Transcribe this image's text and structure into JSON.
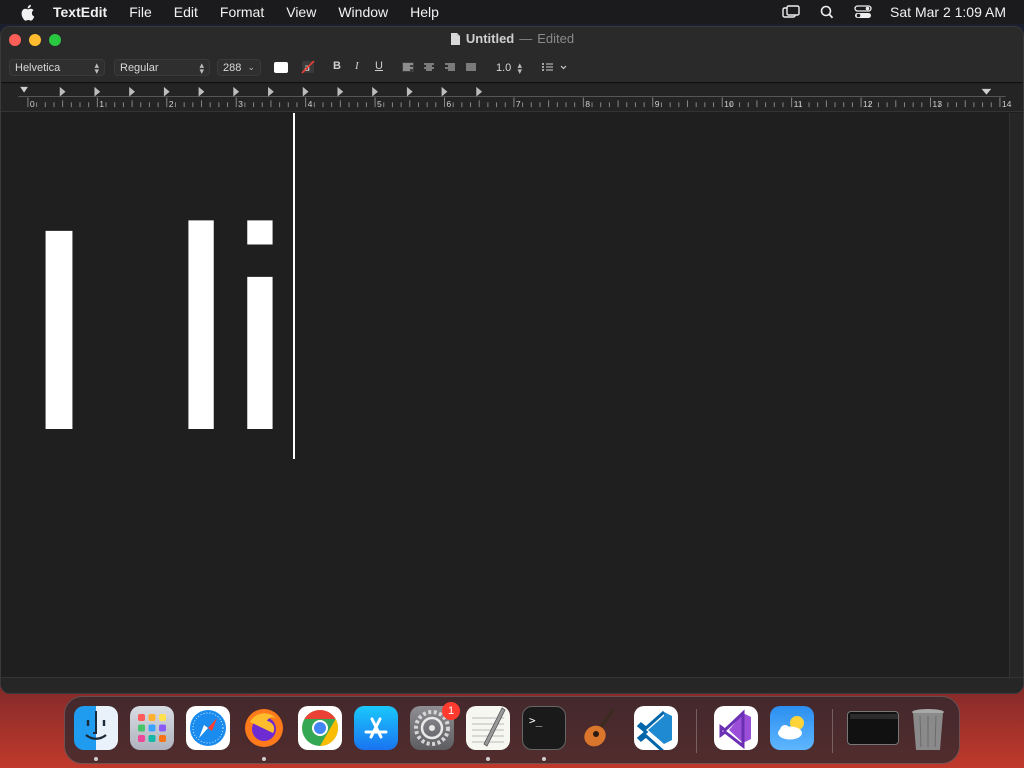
{
  "menubar": {
    "app_name": "TextEdit",
    "menus": [
      "File",
      "Edit",
      "Format",
      "View",
      "Window",
      "Help"
    ],
    "clock": "Sat Mar 2  1:09 AM",
    "status_icons": [
      "screen-mirroring-icon",
      "search-icon",
      "control-center-icon"
    ]
  },
  "window": {
    "title": "Untitled",
    "separator": "—",
    "state": "Edited"
  },
  "toolbar": {
    "font_family": "Helvetica",
    "font_style": "Regular",
    "font_size": "288",
    "bold_label": "B",
    "italic_label": "I",
    "underline_label": "U",
    "line_spacing": "1.0",
    "text_color": "#ffffff"
  },
  "ruler": {
    "marks": [
      "0",
      "1",
      "2",
      "3",
      "4",
      "5",
      "6",
      "7",
      "8",
      "9",
      "10",
      "11",
      "12",
      "13",
      "14"
    ]
  },
  "document": {
    "text": [
      "I",
      "l",
      "i"
    ]
  },
  "dock": {
    "apps": [
      "Finder",
      "Launchpad",
      "Safari",
      "Firefox",
      "Google Chrome",
      "App Store",
      "System Settings",
      "TextEdit",
      "Terminal",
      "GarageBand",
      "Visual Studio Code",
      "Visual Studio",
      "Weather",
      "Screen Recording",
      "Trash"
    ],
    "settings_badge": "1"
  }
}
